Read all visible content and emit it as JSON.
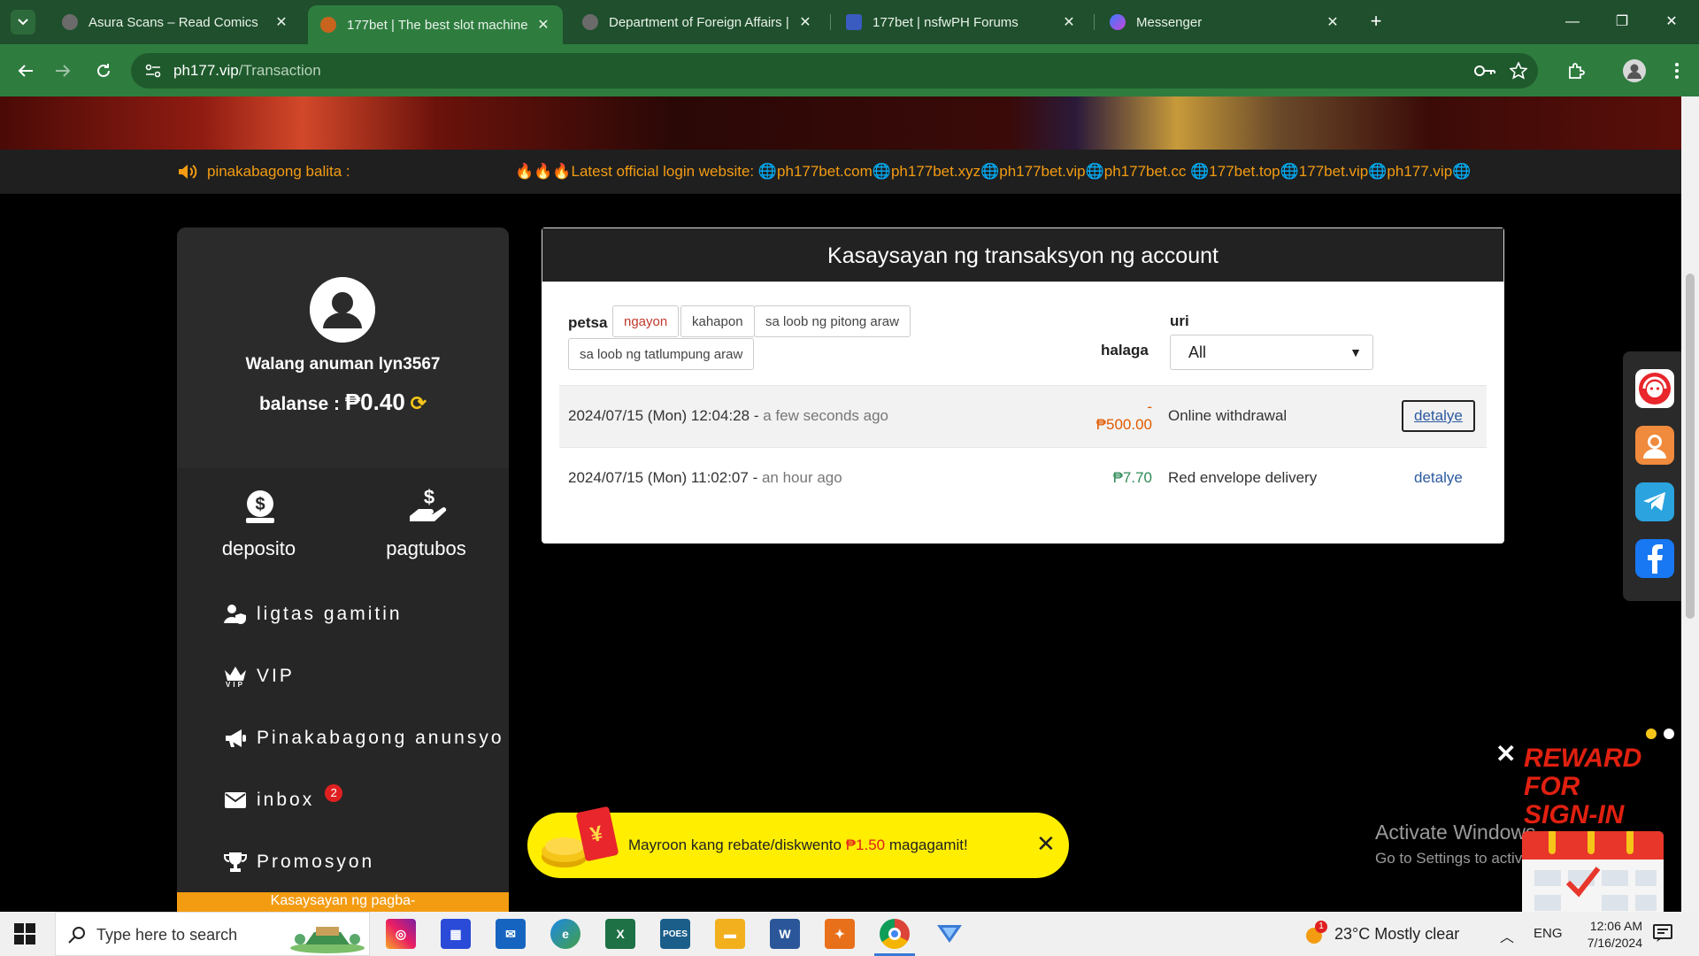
{
  "browser": {
    "tabs": [
      {
        "title": "Asura Scans – Read Comics",
        "active": false
      },
      {
        "title": "177bet | The best slot machine",
        "active": true
      },
      {
        "title": "Department of Foreign Affairs |",
        "active": false
      },
      {
        "title": "177bet | nsfwPH Forums",
        "active": false
      },
      {
        "title": "Messenger",
        "active": false
      }
    ],
    "url_host": "ph177.vip",
    "url_path": "/Transaction"
  },
  "ticker": {
    "label": "pinakabagong balita :",
    "message": "🔥🔥🔥Latest official login website: 🌐ph177bet.com🌐ph177bet.xyz🌐ph177bet.vip🌐ph177bet.cc 🌐177bet.top🌐177bet.vip🌐ph177.vip🌐"
  },
  "sidebar": {
    "username": "Walang anuman lyn3567",
    "balance_label": "balanse :",
    "balance_value": "₱0.40",
    "quick": {
      "deposit": "deposito",
      "withdraw": "pagtubos"
    },
    "menu": [
      {
        "label": "ligtas gamitin",
        "icon": "user-shield-icon"
      },
      {
        "label": "VIP",
        "icon": "vip-crown-icon"
      },
      {
        "label": "Pinakabagong anunsyo",
        "icon": "megaphone-icon"
      },
      {
        "label": "inbox",
        "icon": "envelope-icon",
        "badge": "2"
      },
      {
        "label": "Promosyon",
        "icon": "trophy-icon"
      }
    ],
    "bottom_tab": "Kasaysayan ng pagba-"
  },
  "transactions": {
    "title": "Kasaysayan ng transaksyon ng account",
    "filters": {
      "date_label": "petsa",
      "ranges": [
        "ngayon",
        "kahapon",
        "sa loob ng pitong araw",
        "sa loob ng tatlumpung araw"
      ],
      "selected_range": "ngayon",
      "amount_label": "halaga",
      "type_label": "uri",
      "type_value": "All"
    },
    "rows": [
      {
        "datetime": "2024/07/15 (Mon) 12:04:28",
        "relative": "a few seconds ago",
        "amount_sign": "-",
        "amount": "₱500.00",
        "type": "Online withdrawal",
        "action": "detalye"
      },
      {
        "datetime": "2024/07/15 (Mon) 11:02:07",
        "relative": "an hour ago",
        "amount_sign": "",
        "amount": "₱7.70",
        "type": "Red envelope delivery",
        "action": "detalye"
      }
    ]
  },
  "toast": {
    "text_before": "Mayroon kang rebate/diskwento ",
    "amount": "₱1.50",
    "text_after": " magagamit!"
  },
  "reward": {
    "line1": "REWARD",
    "line2": "FOR",
    "line3": "SIGN-IN"
  },
  "watermark": {
    "line1": "Activate Windows",
    "line2": "Go to Settings to activate Windows."
  },
  "taskbar": {
    "search_placeholder": "Type here to search",
    "weather": "23°C  Mostly clear",
    "weather_badge": "1",
    "lang": "ENG",
    "time": "12:06 AM",
    "date": "7/16/2024"
  },
  "colors": {
    "accent_orange": "#f39c12",
    "browser_green": "#2e7d3f",
    "toast_yellow": "#ffee00",
    "negative_amount": "#e05a00",
    "positive_amount": "#2e8b57"
  }
}
